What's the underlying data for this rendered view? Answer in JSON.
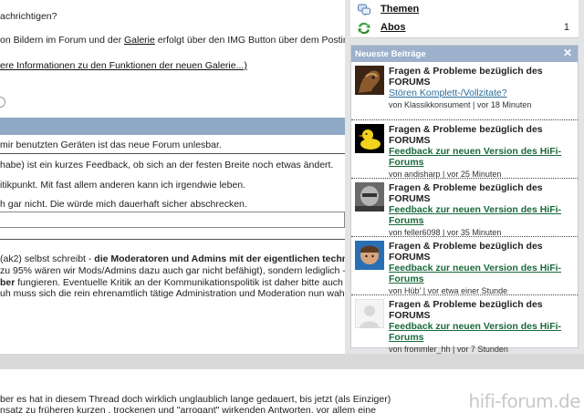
{
  "left": {
    "line1": "achrichtigen?",
    "line2_pre": "on Bildern im Forum und der ",
    "line2_link": "Galerie",
    "line2_post": " erfolgt über den IMG Button über dem Posting-",
    "line3_link": "ere Informationen zu den Funktionen der neuen Galerie...)",
    "line4": "mir benutzten Geräten ist das neue Forum unlesbar.",
    "line5": "habe) ist ein kurzes Feedback, ob sich an der festen Breite noch etwas ändert.",
    "line6": "itikpunkt. Mit fast allem anderen kann ich irgendwie leben.",
    "line7": "h gar nicht. Die würde mich dauerhaft sicher abschrecken.",
    "line8_pre": "(ak2) selbst schreibt - ",
    "line8_bold": "die Moderatoren und Admins mit der eigentlichen technischen",
    "line9": "zu 95% wären wir Mods/Admins dazu auch gar nicht befähigt), sondern lediglich - wie d",
    "line10_bold": "ber",
    "line10_post": " fungieren. Eventuelle Kritik an der Kommunikationspolitik ist daher bitte auch unmitte",
    "line11": "uh muss sich die rein ehrenamtlich tätige Administration und Moderation nun wahrlich n",
    "line12": "ber es hat in diesem Thread doch wirklich unglaublich lange gedauert, bis jetzt (als Einziger)",
    "line13": "nsatz zu früheren kurzen , trockenen und \"arrogant\" wirkenden Antworten, vor allem eine"
  },
  "sidebar": {
    "rows": [
      {
        "label": "Themen",
        "icon": "speech-bubbles-icon",
        "count": ""
      },
      {
        "label": "Abos",
        "icon": "green-arrows-icon",
        "count": "1"
      }
    ],
    "panel_title": "Neueste Beiträge",
    "entries": [
      {
        "title": "Fragen & Probleme bezüglich des FORUMS",
        "subject": "Stören Komplett-/Vollzitate?",
        "meta": "von Klassikkonsument | vor 18 Minuten",
        "avatar": "pony-avatar"
      },
      {
        "title": "Fragen & Probleme bezüglich des FORUMS",
        "subject": "Feedback zur neuen Version des HiFi-Forums",
        "meta": "von andisharp | vor 25 Minuten",
        "avatar": "rubber-duck-avatar"
      },
      {
        "title": "Fragen & Probleme bezüglich des FORUMS",
        "subject": "Feedback zur neuen Version des HiFi-Forums",
        "meta": "von feller6098 | vor 35 Minuten",
        "avatar": "grey-face-avatar"
      },
      {
        "title": "Fragen & Probleme bezüglich des FORUMS",
        "subject": "Feedback zur neuen Version des HiFi-Forums",
        "meta": "von Hüb' | vor etwa einer Stunde",
        "avatar": "blue-face-avatar"
      },
      {
        "title": "Fragen & Probleme bezüglich des FORUMS",
        "subject": "Feedback zur neuen Version des HiFi-Forums",
        "meta": "von frommler_hh | vor 7 Stunden",
        "avatar": "default-avatar"
      }
    ]
  },
  "watermark": "hifi-forum.de",
  "colors": {
    "panel_header": "#9db1cc",
    "subject_green": "#1a6a3a",
    "subject_blue": "#2a6c9c"
  }
}
